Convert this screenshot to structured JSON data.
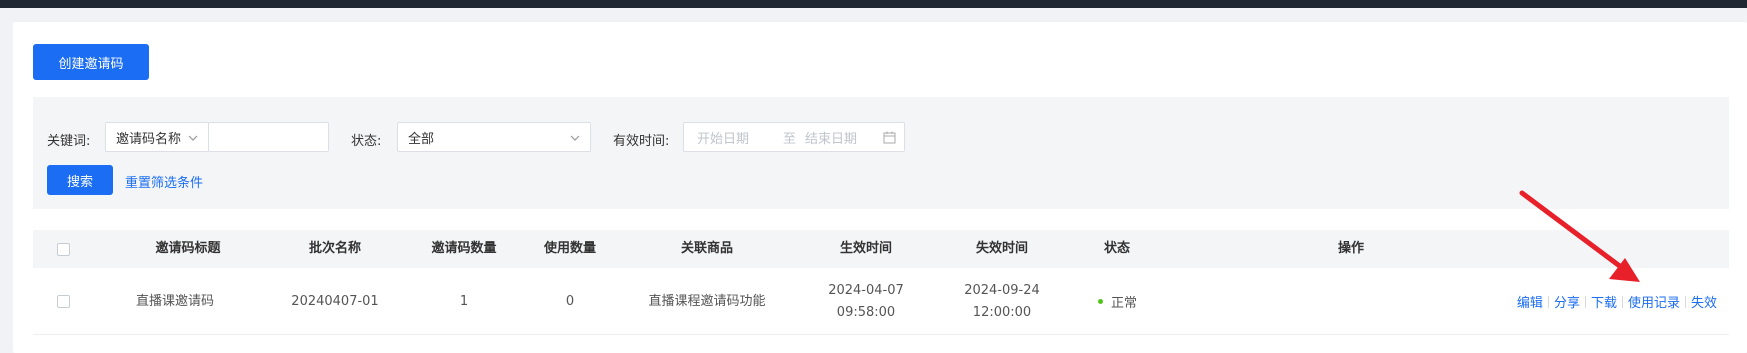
{
  "toolbar": {
    "create_label": "创建邀请码"
  },
  "filters": {
    "keyword_label": "关键词:",
    "keyword_type": "邀请码名称",
    "keyword_value": "",
    "status_label": "状态:",
    "status_value": "全部",
    "valid_time_label": "有效时间:",
    "start_placeholder": "开始日期",
    "range_separator": "至",
    "end_placeholder": "结束日期",
    "search_label": "搜索",
    "reset_label": "重置筛选条件"
  },
  "table": {
    "columns": [
      "邀请码标题",
      "批次名称",
      "邀请码数量",
      "使用数量",
      "关联商品",
      "生效时间",
      "失效时间",
      "状态",
      "操作"
    ],
    "rows": [
      {
        "title": "直播课邀请码",
        "batch": "20240407-01",
        "count": "1",
        "used": "0",
        "product": "直播课程邀请码功能",
        "start_date": "2024-04-07",
        "start_time": "09:58:00",
        "end_date": "2024-09-24",
        "end_time": "12:00:00",
        "status": "正常",
        "actions": [
          "编辑",
          "分享",
          "下载",
          "使用记录",
          "失效"
        ]
      }
    ]
  },
  "colors": {
    "primary": "#1b6ef3",
    "status_ok": "#52c41a",
    "annotation": "#e8202a"
  }
}
